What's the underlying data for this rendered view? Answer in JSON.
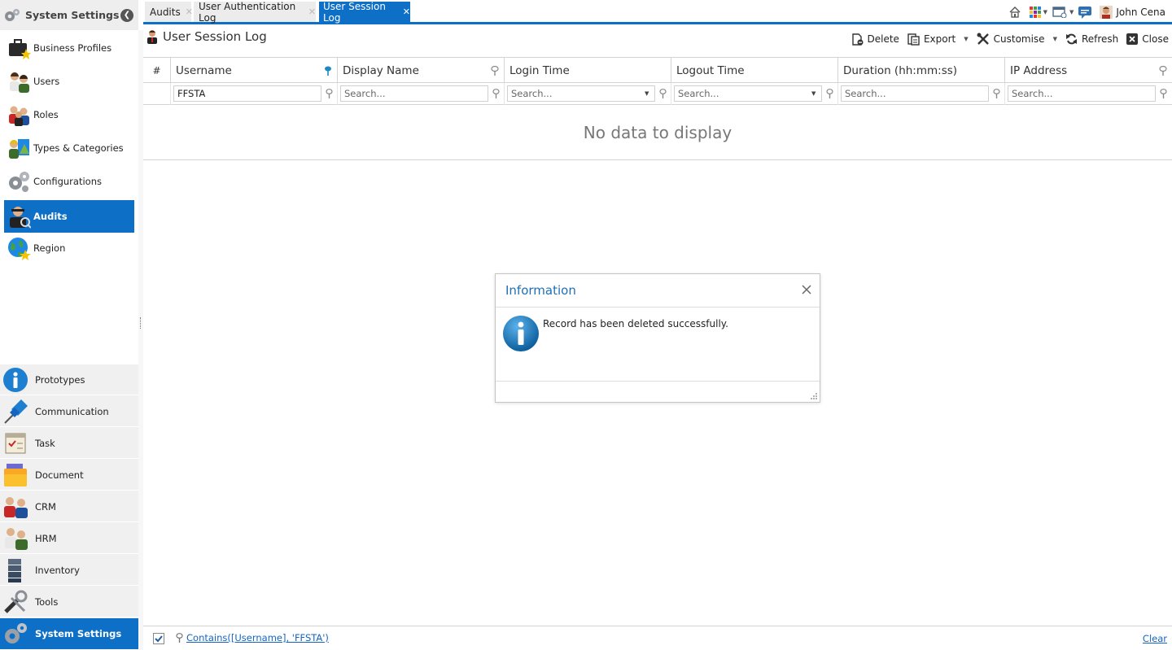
{
  "sidebar": {
    "title": "System Settings",
    "items": [
      {
        "label": "Business Profiles",
        "icon": "briefcase-icon"
      },
      {
        "label": "Users",
        "icon": "users-icon"
      },
      {
        "label": "Roles",
        "icon": "roles-icon"
      },
      {
        "label": "Types & Categories",
        "icon": "types-categories-icon"
      },
      {
        "label": "Configurations",
        "icon": "gears-icon"
      },
      {
        "label": "Audits",
        "icon": "auditor-icon",
        "active": true
      },
      {
        "label": "Region",
        "icon": "globe-icon"
      }
    ],
    "groups": [
      {
        "label": "Prototypes",
        "icon": "info-icon"
      },
      {
        "label": "Communication",
        "icon": "pushpin-icon"
      },
      {
        "label": "Task",
        "icon": "checklist-icon"
      },
      {
        "label": "Document",
        "icon": "folder-icon"
      },
      {
        "label": "CRM",
        "icon": "crm-people-icon"
      },
      {
        "label": "HRM",
        "icon": "hrm-people-icon"
      },
      {
        "label": "Inventory",
        "icon": "inventory-stack-icon"
      },
      {
        "label": "Tools",
        "icon": "tools-icon"
      },
      {
        "label": "System Settings",
        "icon": "gears-icon",
        "active": true
      }
    ]
  },
  "tabs": [
    {
      "label": "Audits",
      "active": false
    },
    {
      "label": "User Authentication Log",
      "active": false
    },
    {
      "label": "User Session Log",
      "active": true
    }
  ],
  "topbar": {
    "user_name": "John Cena"
  },
  "page": {
    "title": "User Session Log"
  },
  "toolbar": {
    "delete_label": "Delete",
    "export_label": "Export",
    "customise_label": "Customise",
    "refresh_label": "Refresh",
    "close_label": "Close"
  },
  "grid": {
    "row_number_header": "#",
    "columns": [
      "Username",
      "Display Name",
      "Login Time",
      "Logout Time",
      "Duration (hh:mm:ss)",
      "IP Address"
    ],
    "filters": {
      "username_value": "FFSTA",
      "placeholder": "Search..."
    },
    "empty_text": "No data to display"
  },
  "footer": {
    "filter_expression": "Contains([Username], 'FFSTA')",
    "clear_label": "Clear"
  },
  "dialog": {
    "title": "Information",
    "message": "Record has been deleted successfully."
  },
  "colors": {
    "accent": "#0e6fc7",
    "dialog_title": "#1f6fb5",
    "link": "#1565c0"
  }
}
